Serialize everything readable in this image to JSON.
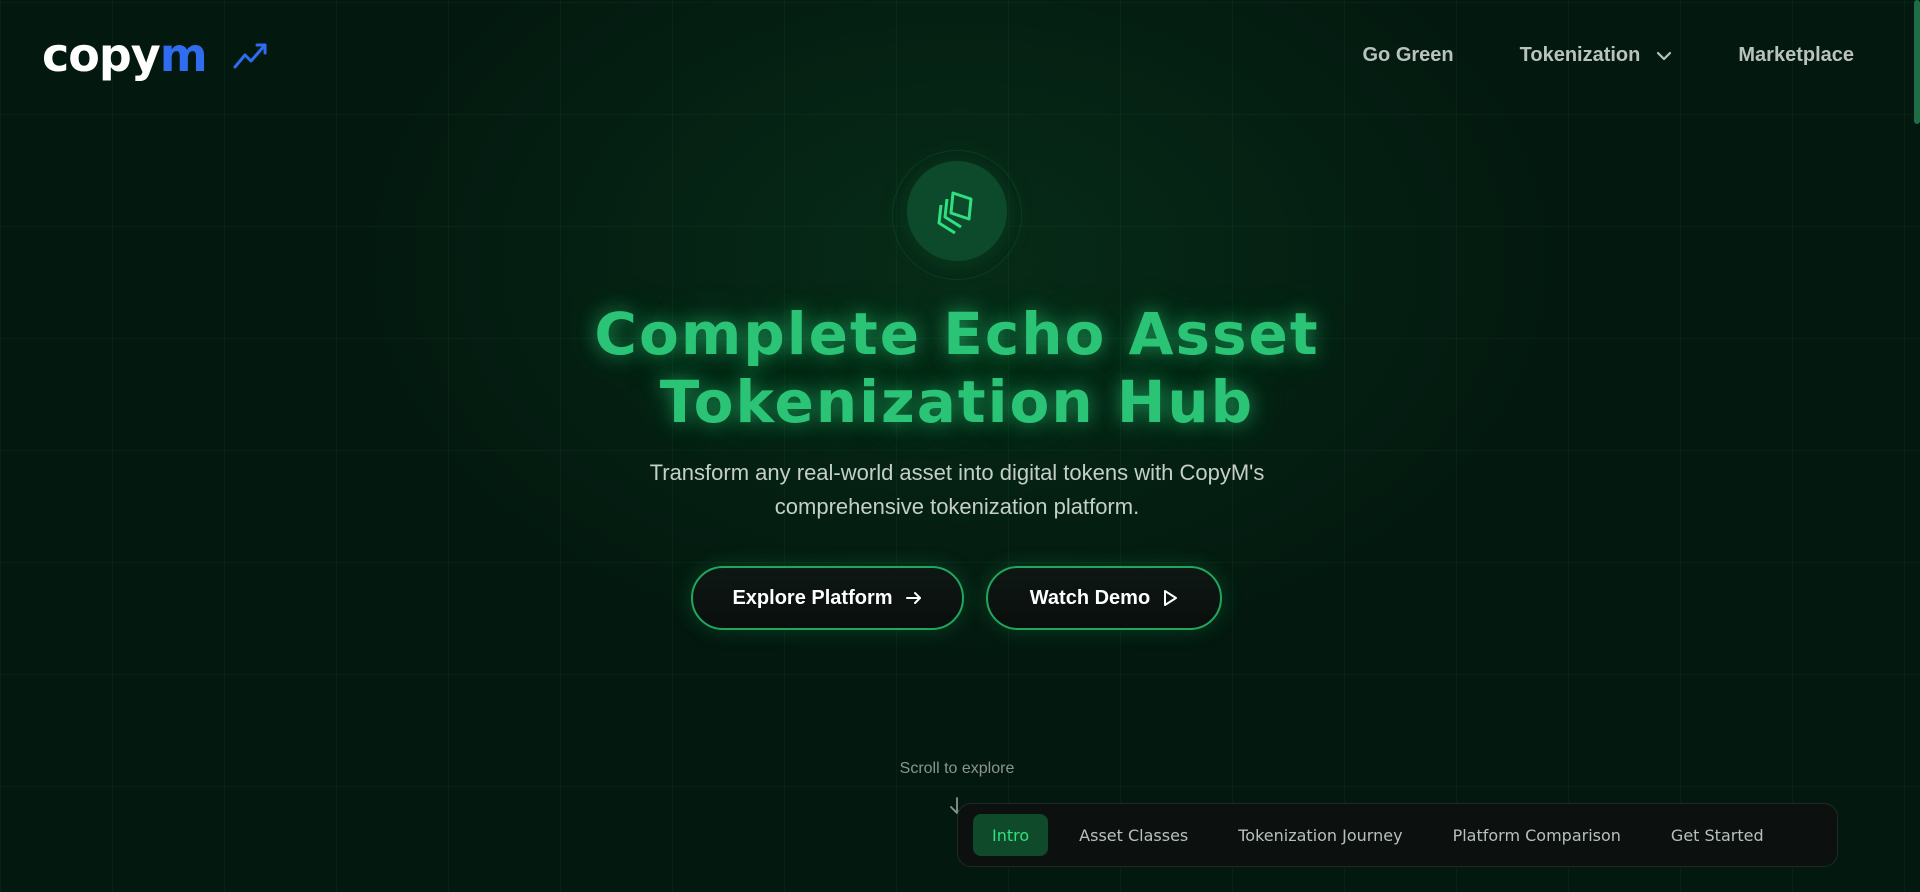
{
  "header": {
    "logo_text_main": "copy",
    "logo_text_accent": "m",
    "nav": [
      {
        "label": "Go Green",
        "has_dropdown": false
      },
      {
        "label": "Tokenization",
        "has_dropdown": true
      },
      {
        "label": "Marketplace",
        "has_dropdown": false
      }
    ]
  },
  "hero": {
    "title_line1": "Complete Echo Asset",
    "title_line2": "Tokenization Hub",
    "subtitle_line1": "Transform any real-world asset into digital tokens with CopyM's",
    "subtitle_line2": "comprehensive tokenization platform.",
    "primary_button": "Explore Platform",
    "secondary_button": "Watch Demo",
    "scroll_hint": "Scroll to explore"
  },
  "section_nav": {
    "tabs": [
      {
        "label": "Intro",
        "active": true
      },
      {
        "label": "Asset Classes",
        "active": false
      },
      {
        "label": "Tokenization Journey",
        "active": false
      },
      {
        "label": "Platform Comparison",
        "active": false
      },
      {
        "label": "Get Started",
        "active": false
      }
    ]
  },
  "colors": {
    "background": "#03180f",
    "accent_green": "#2bc476",
    "logo_accent_blue": "#2f6cf0"
  },
  "icons": {
    "logo": "trend-line-icon",
    "hero": "layers-icon",
    "primary_button": "arrow-right-icon",
    "secondary_button": "play-icon",
    "scroll": "arrow-down-icon",
    "dropdown": "chevron-down-icon"
  }
}
